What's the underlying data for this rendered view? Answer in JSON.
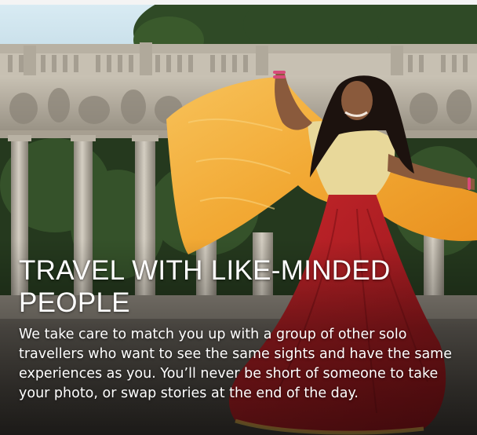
{
  "feature": {
    "headline": "TRAVEL WITH LIKE-MINDED PEOPLE",
    "body": "We take care to match you up with a group of other solo travellers who want to see the same sights and have the same experiences as you. You’ll never be short of someone to take your photo, or swap stories at the end of the day."
  },
  "photo": {
    "subject": "woman-dancing-with-scarf-icon",
    "colors": {
      "sky": "#cfe4ef",
      "stone": "#b9b3a6",
      "foliage": "#2f4a26",
      "scarf": "#f2a934",
      "skirt": "#b31e24",
      "top": "#e8d89a",
      "skin": "#8a5a3c",
      "hair": "#1c120e"
    }
  }
}
